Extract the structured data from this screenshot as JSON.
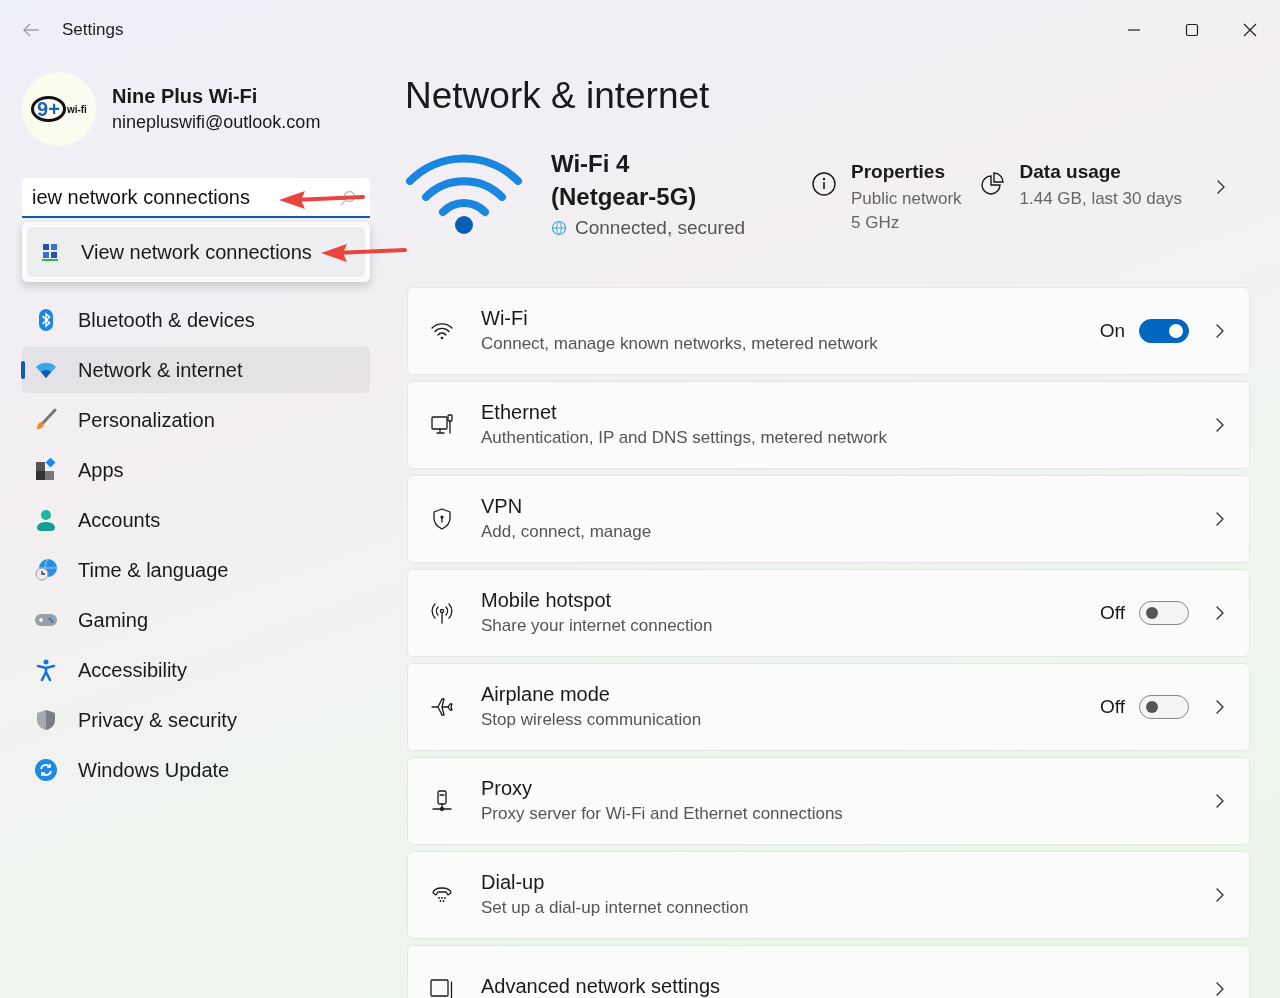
{
  "window": {
    "title": "Settings"
  },
  "profile": {
    "logo_mark": "9+",
    "logo_caption": "wi-fi",
    "name": "Nine Plus Wi-Fi",
    "email": "ninepluswifi@outlook.com"
  },
  "search": {
    "value": "iew network connections",
    "suggestions": [
      {
        "label": "View network connections",
        "selected": true
      }
    ]
  },
  "sidebar": {
    "items": [
      {
        "label": "Bluetooth & devices",
        "selected": false
      },
      {
        "label": "Network & internet",
        "selected": true
      },
      {
        "label": "Personalization",
        "selected": false
      },
      {
        "label": "Apps",
        "selected": false
      },
      {
        "label": "Accounts",
        "selected": false
      },
      {
        "label": "Time & language",
        "selected": false
      },
      {
        "label": "Gaming",
        "selected": false
      },
      {
        "label": "Accessibility",
        "selected": false
      },
      {
        "label": "Privacy & security",
        "selected": false
      },
      {
        "label": "Windows Update",
        "selected": false
      }
    ]
  },
  "page": {
    "title": "Network & internet"
  },
  "connection": {
    "name_lines": [
      "Wi-Fi 4",
      "(Netgear-5G)"
    ],
    "status": "Connected, secured",
    "properties": {
      "title": "Properties",
      "lines": [
        "Public network",
        "5 GHz"
      ]
    },
    "data_usage": {
      "title": "Data usage",
      "lines": [
        "1.44 GB, last 30 days"
      ]
    }
  },
  "rows": [
    {
      "kind": "toggle",
      "title": "Wi-Fi",
      "subtitle": "Connect, manage known networks, metered network",
      "state_label": "On",
      "on": true
    },
    {
      "kind": "link",
      "title": "Ethernet",
      "subtitle": "Authentication, IP and DNS settings, metered network"
    },
    {
      "kind": "link",
      "title": "VPN",
      "subtitle": "Add, connect, manage"
    },
    {
      "kind": "toggle",
      "title": "Mobile hotspot",
      "subtitle": "Share your internet connection",
      "state_label": "Off",
      "on": false
    },
    {
      "kind": "toggle",
      "title": "Airplane mode",
      "subtitle": "Stop wireless communication",
      "state_label": "Off",
      "on": false
    },
    {
      "kind": "link",
      "title": "Proxy",
      "subtitle": "Proxy server for Wi-Fi and Ethernet connections"
    },
    {
      "kind": "link",
      "title": "Dial-up",
      "subtitle": "Set up a dial-up internet connection"
    },
    {
      "kind": "link",
      "title": "Advanced network settings"
    }
  ]
}
